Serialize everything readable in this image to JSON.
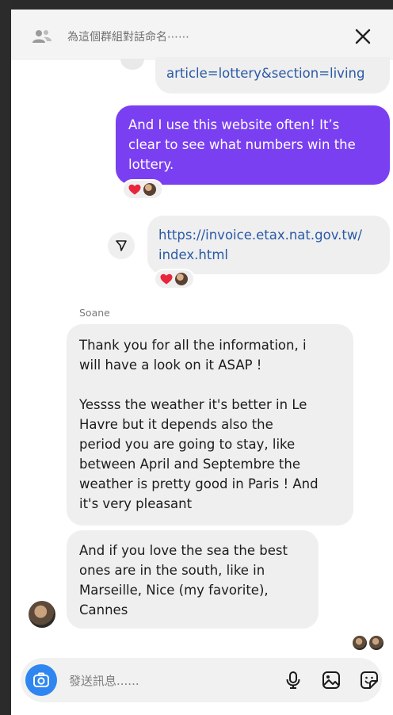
{
  "header": {
    "title": "為這個群組對話命名⋯⋯",
    "people_icon": "people-icon",
    "close_icon": "close-icon"
  },
  "messages": [
    {
      "type": "outgoing-link",
      "text": "article=lottery&section=living"
    },
    {
      "type": "outgoing",
      "lines": [
        "And I use this website often! It’s",
        "clear to see what numbers win the",
        "lottery."
      ]
    },
    {
      "type": "outgoing-link",
      "lines": [
        "https://invoice.etax.nat.gov.tw/",
        "index.html"
      ]
    },
    {
      "type": "incoming",
      "sender": "Soane",
      "lines": [
        "Thank you for all the information, i",
        "will have a look on it ASAP !",
        "",
        "Yessss the weather it's better in Le",
        "Havre but it depends also the",
        "period you are going to stay, like",
        "between April and Septembre the",
        "weather is pretty good in Paris ! And",
        "it's very pleasant"
      ]
    },
    {
      "type": "incoming",
      "lines": [
        "And if you love the sea the best",
        "ones are in the south, like in",
        "Marseille, Nice (my favorite),",
        "Cannes"
      ]
    }
  ],
  "composer": {
    "placeholder": "發送訊息......",
    "icons": [
      "camera-icon",
      "microphone-icon",
      "image-icon",
      "sticker-icon"
    ]
  },
  "colors": {
    "accent_purple": "#7b3ff2",
    "link_blue": "#2a5aa6",
    "camera_blue": "#2f86f0",
    "bubble_gray": "#efefef"
  }
}
